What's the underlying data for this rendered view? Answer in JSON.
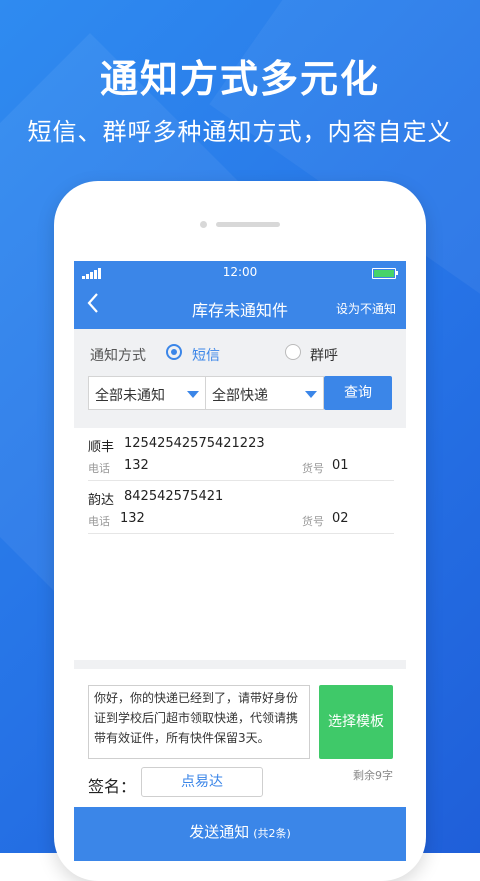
{
  "promo": {
    "headline": "通知方式多元化",
    "subline": "短信、群呼多种通知方式，内容自定义"
  },
  "status_bar": {
    "time": "12:00"
  },
  "nav": {
    "back_icon": "chevron-left-icon",
    "title": "库存未通知件",
    "right_action": "设为不通知"
  },
  "filter": {
    "notify_label": "通知方式",
    "options": [
      {
        "label": "短信",
        "selected": true
      },
      {
        "label": "群呼",
        "selected": false
      }
    ],
    "status_select": "全部未通知",
    "courier_select": "全部快递",
    "query_button": "查询"
  },
  "list": {
    "phone_label": "电话",
    "goods_label": "货号",
    "items": [
      {
        "courier": "顺丰",
        "tracking": "12542542575421223",
        "phone": "132",
        "goods_no": "01"
      },
      {
        "courier": "韵达",
        "tracking": "842542575421",
        "phone": "132",
        "goods_no": "02"
      }
    ]
  },
  "message": {
    "text": "你好，你的快递已经到了，请带好身份证到学校后门超市领取快递，代领请携带有效证件，所有快件保留3天。",
    "template_button": "选择模板",
    "remaining": "剩余9字",
    "sign_label": "签名：",
    "sign_value": "点易达"
  },
  "send": {
    "label": "发送通知",
    "count": "(共2条)"
  },
  "colors": {
    "primary": "#3b86e8",
    "green": "#3fc969",
    "background": "#2673e6"
  }
}
